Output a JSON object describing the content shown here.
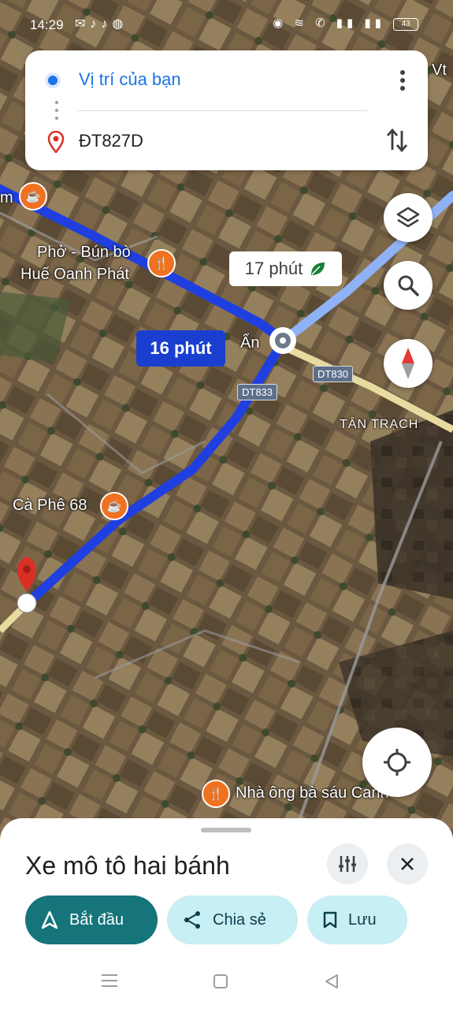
{
  "status_bar": {
    "time": "14:29",
    "battery": "43"
  },
  "directions": {
    "origin": "Vị trí của bạn",
    "destination": "ĐT827D"
  },
  "map": {
    "edge_label": "Vt",
    "poi_labels": {
      "pho": "Phở - Bún bò\nHuế Oanh Phát",
      "pho_line1": "Phở - Bún bò",
      "pho_line2": "Huế Oanh Phát",
      "cafe": "Cà Phê 68",
      "nha": "Nhà ông bà sáu Canh",
      "an": "Ẩn",
      "tan_trach": "TÂN TRẠCH",
      "left_m": "m"
    },
    "roads": {
      "dt830": "DT830",
      "dt833": "DT833"
    },
    "eta_primary": "16 phút",
    "eta_alt": "17 phút"
  },
  "sheet": {
    "title": "Xe mô tô hai bánh",
    "start": "Bắt đầu",
    "share": "Chia sẻ",
    "save": "Lưu"
  },
  "colors": {
    "route": "#1f3fe0",
    "alt_route": "#8fb2f7",
    "primary_button": "#16747b",
    "secondary_button": "#c8eff4"
  }
}
